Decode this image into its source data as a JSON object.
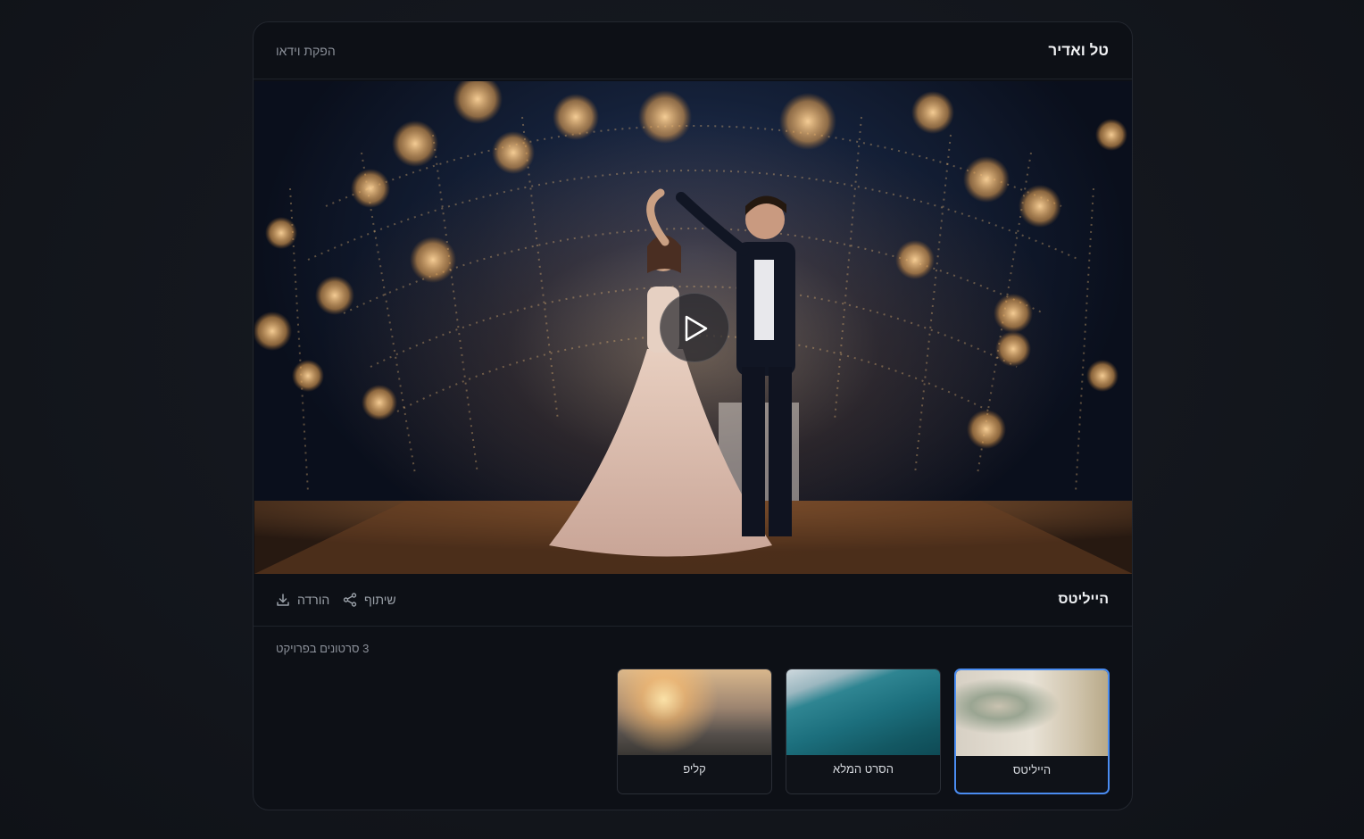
{
  "header": {
    "title": "טל ואדיר",
    "subtitle": "הפקת וידאו"
  },
  "player": {
    "play_icon": "play-icon"
  },
  "toolbar": {
    "video_title": "הייליטס",
    "share_label": "שיתוף",
    "share_icon": "share-icon",
    "download_label": "הורדה",
    "download_icon": "download-icon"
  },
  "project": {
    "count_text": "3 סרטונים בפרויקט"
  },
  "videos": [
    {
      "label": "הייליטס",
      "active": true
    },
    {
      "label": "הסרט המלא",
      "active": false
    },
    {
      "label": "קליפ",
      "active": false
    }
  ],
  "colors": {
    "accent": "#4a8cf0",
    "card_bg": "#0d1016",
    "page_bg": "#14171d"
  }
}
